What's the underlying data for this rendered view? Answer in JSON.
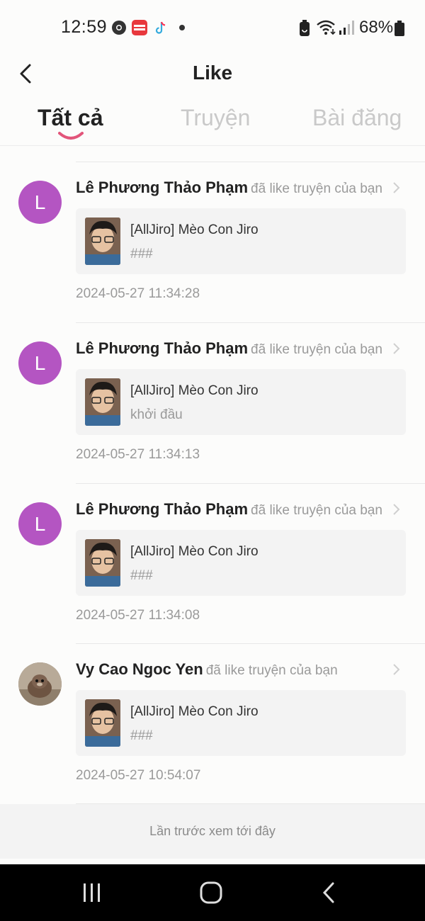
{
  "status_bar": {
    "time": "12:59",
    "battery_text": "68%",
    "icons": [
      "chrome-icon",
      "mangatoon-icon",
      "tiktok-icon",
      "notification-dot",
      "battery-saver-icon",
      "wifi-icon",
      "signal-icon",
      "battery-icon"
    ]
  },
  "header": {
    "title": "Like"
  },
  "tabs": [
    {
      "label": "Tất cả",
      "active": true
    },
    {
      "label": "Truyện",
      "active": false
    },
    {
      "label": "Bài đăng",
      "active": false
    }
  ],
  "notifications": [
    {
      "avatar_letter": "L",
      "user": "Lê Phương Thảo Phạm",
      "action": "đã like truyện của bạn",
      "story_title": "[AllJiro] Mèo Con Jiro",
      "chapter": "###",
      "timestamp": "2024-05-27 11:34:28"
    },
    {
      "avatar_letter": "L",
      "user": "Lê Phương Thảo Phạm",
      "action": "đã like truyện của bạn",
      "story_title": "[AllJiro] Mèo Con Jiro",
      "chapter": "khởi đầu",
      "timestamp": "2024-05-27 11:34:13"
    },
    {
      "avatar_letter": "L",
      "user": "Lê Phương Thảo Phạm",
      "action": "đã like truyện của bạn",
      "story_title": "[AllJiro] Mèo Con Jiro",
      "chapter": "###",
      "timestamp": "2024-05-27 11:34:08"
    },
    {
      "avatar_letter": "",
      "user": "Vy Cao Ngoc Yen",
      "action": "đã like truyện của bạn",
      "story_title": "[AllJiro] Mèo Con Jiro",
      "chapter": "###",
      "timestamp": "2024-05-27 10:54:07"
    }
  ],
  "footer": {
    "last_seen": "Lần trước xem tới đây"
  },
  "colors": {
    "avatar_purple": "#b455c2",
    "tab_indicator": "#e2557a",
    "inactive_tab": "#c9c9c9",
    "muted_text": "#9a9a9a"
  }
}
